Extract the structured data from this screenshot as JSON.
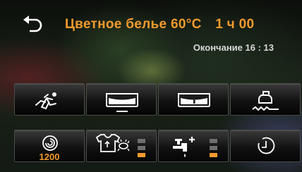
{
  "header": {
    "program": "Цветное белье",
    "temperature": "60°C",
    "duration": "1 ч 00",
    "end_time": "Окончание 16 : 13"
  },
  "buttons_row1": [
    {
      "icon": "quick-wash-icon"
    },
    {
      "icon": "extra-water-icon"
    },
    {
      "icon": "prewash-icon"
    },
    {
      "icon": "easy-iron-icon"
    }
  ],
  "buttons_row2": {
    "spin": {
      "icon": "spin-icon",
      "value": "1200"
    },
    "soil": {
      "icon": "soil-level-icon",
      "level": 1,
      "max": 3
    },
    "rinse": {
      "icon": "rinse-plus-icon",
      "level": 1,
      "max": 3
    },
    "delay": {
      "icon": "delay-timer-icon"
    }
  },
  "colors": {
    "accent": "#f29a2e",
    "icon": "#ffffff",
    "level_off": "#6e6e6e"
  }
}
